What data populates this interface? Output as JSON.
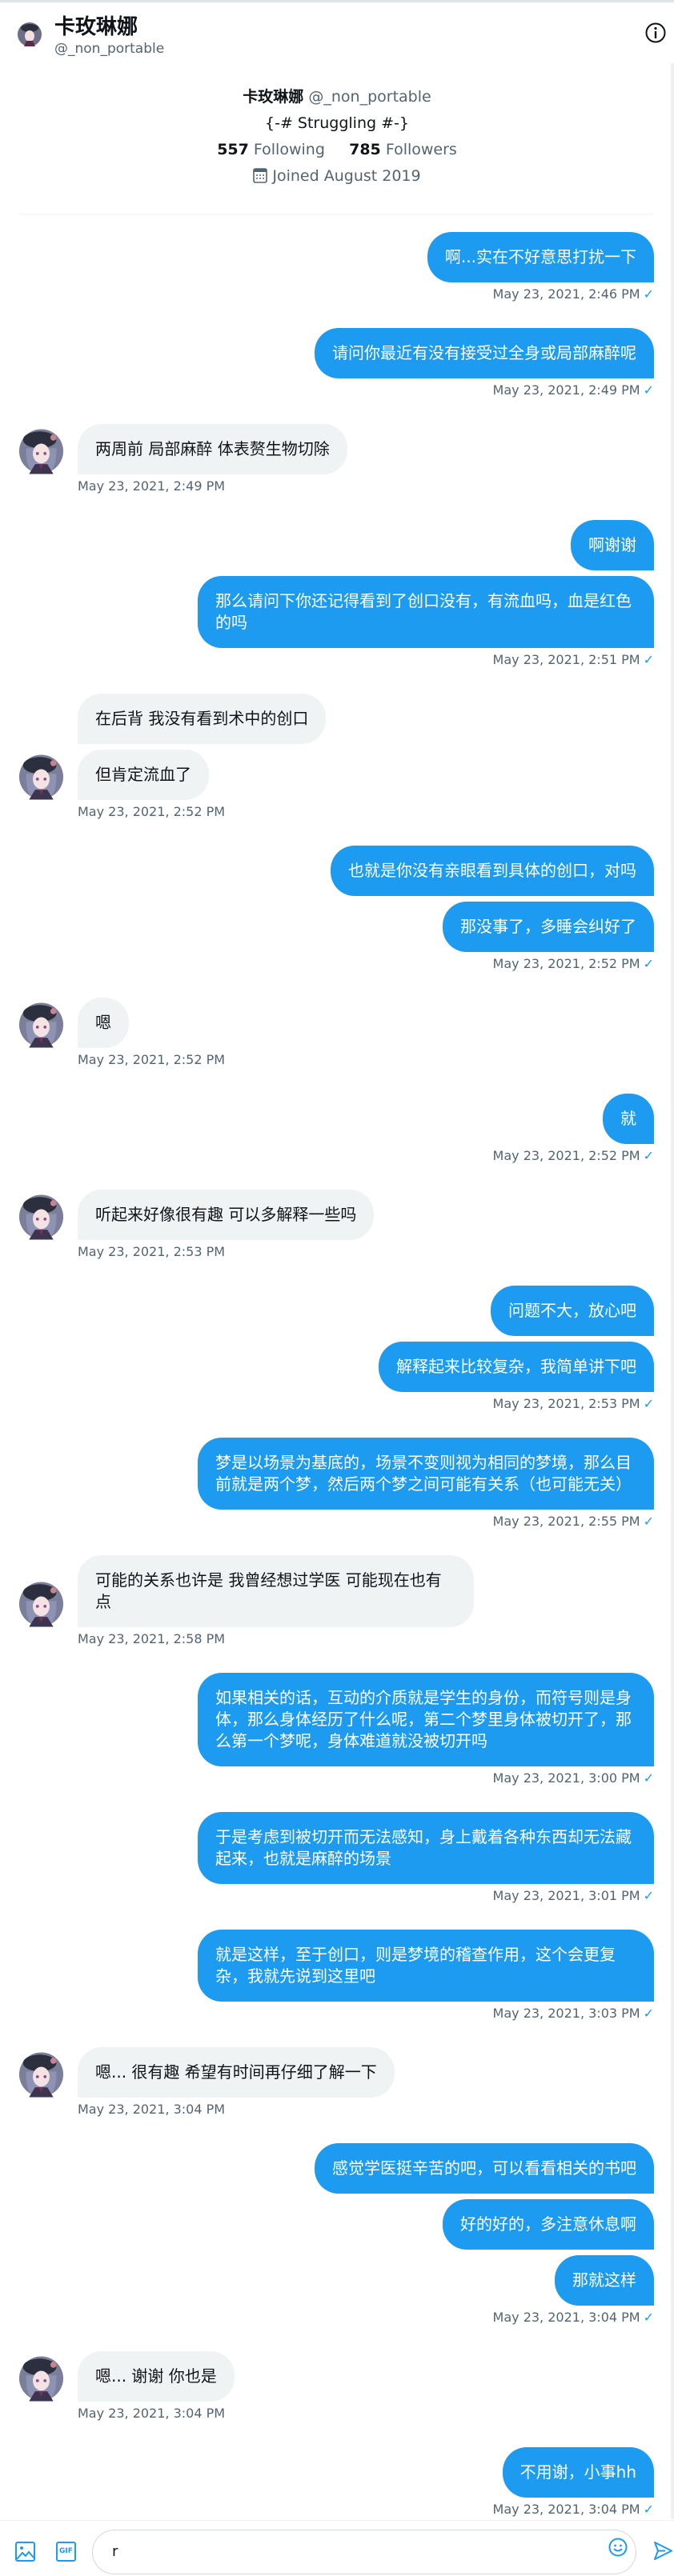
{
  "header": {
    "title": "卡玫琳娜",
    "handle": "@_non_portable",
    "info_icon": "info-circle-icon"
  },
  "profile": {
    "name": "卡玫琳娜",
    "handle": "@_non_portable",
    "bio": "{-# Struggling #-}",
    "following_count": "557",
    "following_label": "Following",
    "followers_count": "785",
    "followers_label": "Followers",
    "joined": "Joined August 2019"
  },
  "colors": {
    "sent_bubble": "#1d9bf0",
    "received_bubble": "#eff3f4",
    "timestamp": "#536471"
  },
  "messages": [
    {
      "side": "sent",
      "bubbles": [
        "啊...实在不好意思打扰一下"
      ],
      "time": "May 23, 2021, 2:46 PM",
      "status": "✓"
    },
    {
      "side": "sent",
      "bubbles": [
        "请问你最近有没有接受过全身或局部麻醉呢"
      ],
      "time": "May 23, 2021, 2:49 PM",
      "status": "✓"
    },
    {
      "side": "recv",
      "bubbles": [
        "两周前 局部麻醉 体表赘生物切除"
      ],
      "time": "May 23, 2021, 2:49 PM"
    },
    {
      "side": "sent",
      "bubbles": [
        "啊谢谢",
        "那么请问下你还记得看到了创口没有，有流血吗，血是红色的吗"
      ],
      "time": "May 23, 2021, 2:51 PM",
      "status": "✓"
    },
    {
      "side": "recv",
      "bubbles": [
        "在后背 我没有看到术中的创口",
        "但肯定流血了"
      ],
      "time": "May 23, 2021, 2:52 PM"
    },
    {
      "side": "sent",
      "bubbles": [
        "也就是你没有亲眼看到具体的创口，对吗",
        "那没事了，多睡会纠好了"
      ],
      "time": "May 23, 2021, 2:52 PM",
      "status": "✓"
    },
    {
      "side": "recv",
      "bubbles": [
        "嗯"
      ],
      "time": "May 23, 2021, 2:52 PM"
    },
    {
      "side": "sent",
      "bubbles": [
        "就"
      ],
      "time": "May 23, 2021, 2:52 PM",
      "status": "✓"
    },
    {
      "side": "recv",
      "bubbles": [
        "听起来好像很有趣 可以多解释一些吗"
      ],
      "time": "May 23, 2021, 2:53 PM"
    },
    {
      "side": "sent",
      "bubbles": [
        "问题不大，放心吧",
        "解释起来比较复杂，我简单讲下吧"
      ],
      "time": "May 23, 2021, 2:53 PM",
      "status": "✓"
    },
    {
      "side": "sent",
      "bubbles": [
        "梦是以场景为基底的，场景不变则视为相同的梦境，那么目前就是两个梦，然后两个梦之间可能有关系（也可能无关）"
      ],
      "time": "May 23, 2021, 2:55 PM",
      "status": "✓"
    },
    {
      "side": "recv",
      "bubbles": [
        "可能的关系也许是 我曾经想过学医 可能现在也有点"
      ],
      "time": "May 23, 2021, 2:58 PM"
    },
    {
      "side": "sent",
      "bubbles": [
        "如果相关的话，互动的介质就是学生的身份，而符号则是身体，那么身体经历了什么呢，第二个梦里身体被切开了，那么第一个梦呢，身体难道就没被切开吗"
      ],
      "time": "May 23, 2021, 3:00 PM",
      "status": "✓"
    },
    {
      "side": "sent",
      "bubbles": [
        "于是考虑到被切开而无法感知，身上戴着各种东西却无法藏起来，也就是麻醉的场景"
      ],
      "time": "May 23, 2021, 3:01 PM",
      "status": "✓"
    },
    {
      "side": "sent",
      "bubbles": [
        "就是这样，至于创口，则是梦境的稽查作用，这个会更复杂，我就先说到这里吧"
      ],
      "time": "May 23, 2021, 3:03 PM",
      "status": "✓"
    },
    {
      "side": "recv",
      "bubbles": [
        "嗯... 很有趣 希望有时间再仔细了解一下"
      ],
      "time": "May 23, 2021, 3:04 PM"
    },
    {
      "side": "sent",
      "bubbles": [
        "感觉学医挺辛苦的吧，可以看看相关的书吧",
        "好的好的，多注意休息啊",
        "那就这样"
      ],
      "time": "May 23, 2021, 3:04 PM",
      "status": "✓"
    },
    {
      "side": "recv",
      "bubbles": [
        "嗯... 谢谢 你也是"
      ],
      "time": "May 23, 2021, 3:04 PM"
    },
    {
      "side": "sent",
      "bubbles": [
        "不用谢，小事hh"
      ],
      "time": "May 23, 2021, 3:04 PM",
      "status": "✓"
    }
  ],
  "composer": {
    "value": "r",
    "gif_label": "GIF"
  }
}
